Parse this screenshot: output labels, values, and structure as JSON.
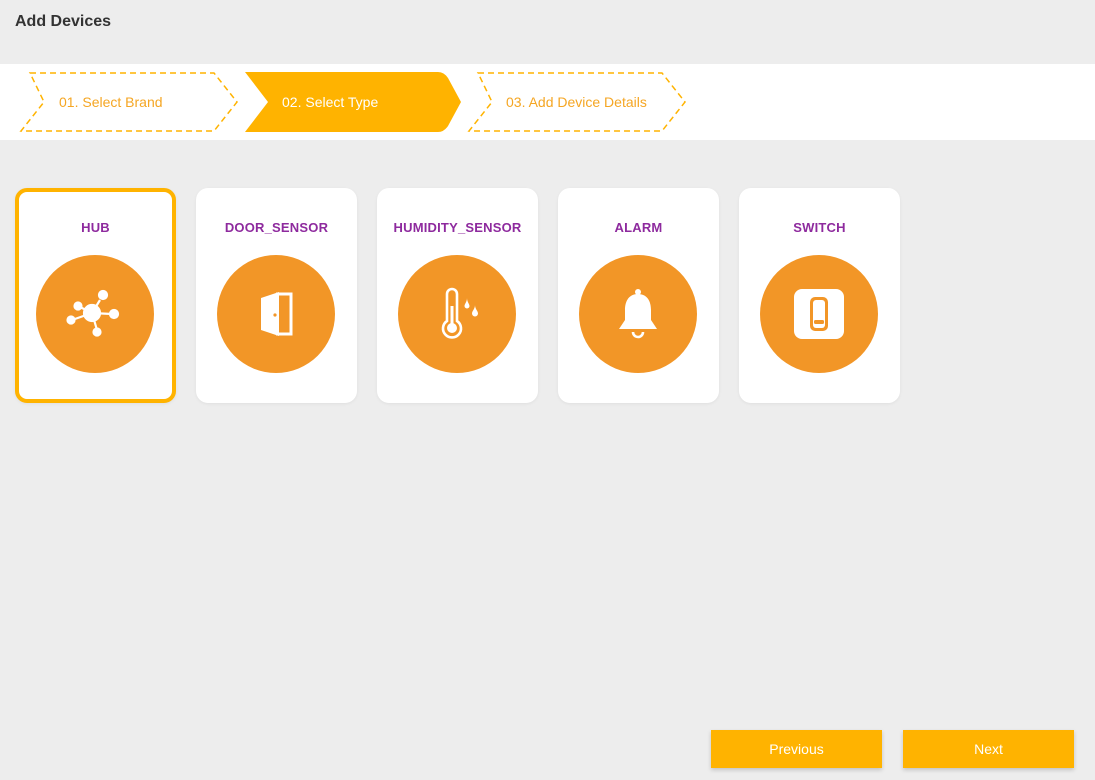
{
  "page": {
    "title": "Add Devices"
  },
  "stepper": {
    "steps": [
      {
        "label": "01. Select Brand",
        "state": "completed"
      },
      {
        "label": "02. Select Type",
        "state": "active"
      },
      {
        "label": "03. Add Device Details",
        "state": "pending"
      }
    ]
  },
  "devices": [
    {
      "name": "HUB",
      "icon": "hub-icon",
      "selected": true
    },
    {
      "name": "DOOR_SENSOR",
      "icon": "door-icon",
      "selected": false
    },
    {
      "name": "HUMIDITY_SENSOR",
      "icon": "thermometer-icon",
      "selected": false
    },
    {
      "name": "ALARM",
      "icon": "bell-icon",
      "selected": false
    },
    {
      "name": "SWITCH",
      "icon": "switch-icon",
      "selected": false
    }
  ],
  "actions": {
    "previous_label": "Previous",
    "next_label": "Next"
  },
  "colors": {
    "accent": "#ffb300",
    "icon_circle": "#f29627",
    "device_label": "#8e2a9e",
    "background": "#ededed"
  }
}
